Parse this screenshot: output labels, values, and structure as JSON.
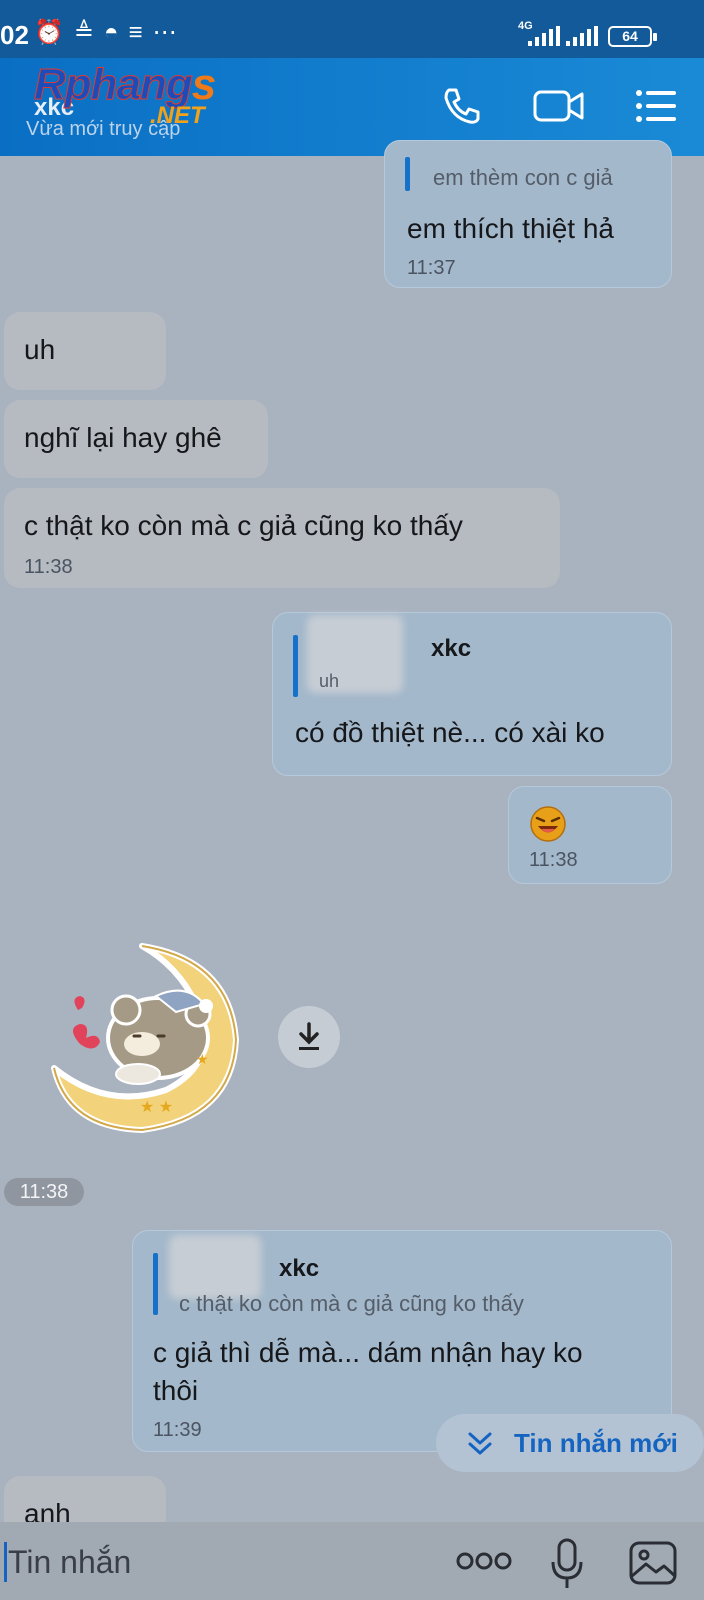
{
  "status_bar": {
    "time": "02",
    "icons": [
      "alarm-icon",
      "notification-icon",
      "silent-icon",
      "menu-icon",
      "more-icon"
    ],
    "network": "4G",
    "battery": "64"
  },
  "header": {
    "title": "xkc",
    "subtitle": "Vừa mới truy cập",
    "watermark": "Rphangs.NET"
  },
  "messages": [
    {
      "text": "em thích thiệt hả",
      "quote_text": "em thèm con c giả",
      "time": "11:37"
    },
    {
      "text": "uh"
    },
    {
      "text": "nghĩ lại hay ghê"
    },
    {
      "text": "c  thật ko còn mà c giả cũng ko thấy",
      "time": "11:38"
    },
    {
      "text": "có đồ thiệt nè... có xài ko",
      "quote_name": "xkc",
      "quote_text": "uh"
    },
    {
      "time": "11:38"
    },
    {
      "time": "11:38"
    },
    {
      "text_line1": "c giả thì dễ mà... dám nhận hay ko",
      "text_line2": "thôi",
      "quote_name": "xkc",
      "quote_text": "c  thật ko còn mà c giả cũng ko thấy",
      "time": "11:39"
    },
    {
      "text": "anh"
    }
  ],
  "new_messages_label": "Tin nhắn mới",
  "input": {
    "placeholder": "Tin nhắn"
  },
  "colors": {
    "accent": "#1565c0",
    "header": "#0a6fc4",
    "background": "#a9b2bf"
  }
}
